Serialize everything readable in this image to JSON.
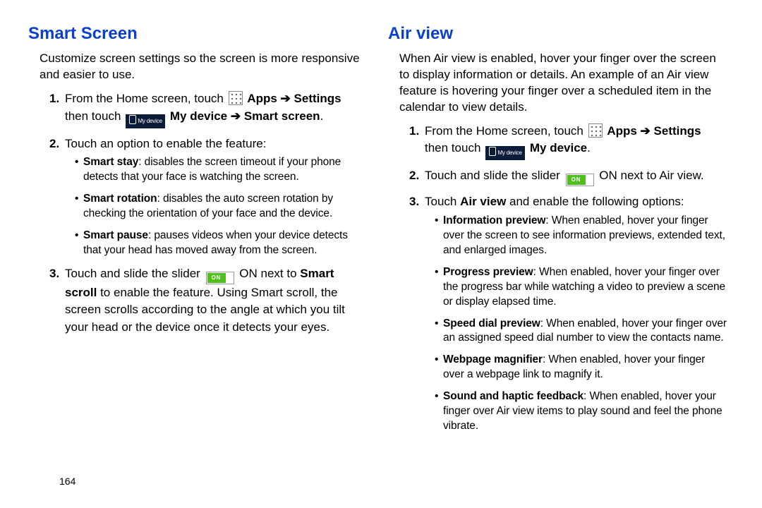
{
  "page_number": "164",
  "arrow": " ➔ ",
  "left": {
    "heading": "Smart Screen",
    "intro": "Customize screen settings so the screen is more responsive and easier to use.",
    "step1_a": "From the Home screen, touch ",
    "step1_apps": "Apps",
    "step1_settings": "Settings",
    "step1_b": "then touch ",
    "step1_mydevice": "My device",
    "step1_smartscreen": "Smart screen",
    "step2": "Touch an option to enable the feature:",
    "opt1_b": "Smart stay",
    "opt1_t": ": disables the screen timeout if your phone detects that your face is watching the screen.",
    "opt2_b": "Smart rotation",
    "opt2_t": ": disables the auto screen rotation by checking the orientation of your face and the device.",
    "opt3_b": "Smart pause",
    "opt3_t": ": pauses videos when your device detects that your head has moved away from the screen.",
    "step3_a": "Touch and slide the slider ",
    "step3_on": " ON next to ",
    "step3_smart": "Smart scroll",
    "step3_rest": " to enable the feature. Using Smart scroll, the screen scrolls according to the angle at which you tilt your head or the device once it detects your eyes.",
    "mydevice_icon_label": "My device",
    "slider_label": "ON"
  },
  "right": {
    "heading": "Air view",
    "intro": "When Air view is enabled, hover your finger over the screen to display information or details. An example of an Air view feature is hovering your finger over a scheduled item in the calendar to view details.",
    "step1_a": "From the Home screen, touch ",
    "step1_apps": "Apps",
    "step1_settings": "Settings",
    "step1_b": "then touch ",
    "step1_mydevice": "My device",
    "step2_a": "Touch and slide the slider ",
    "step2_b": " ON next to Air view.",
    "step3_a": "Touch ",
    "step3_airview": "Air view",
    "step3_b": " and enable the following options:",
    "opt1_b": "Information preview",
    "opt1_t": ": When enabled, hover your finger over the screen to see information previews, extended text, and enlarged images.",
    "opt2_b": "Progress preview",
    "opt2_t": ": When enabled, hover your finger over the progress bar while watching a video to preview a scene or display elapsed time.",
    "opt3_b": "Speed dial preview",
    "opt3_t": ": When enabled, hover your finger over an assigned speed dial number to view the contacts name.",
    "opt4_b": "Webpage magnifier",
    "opt4_t": ": When enabled, hover your finger over a webpage link to magnify it.",
    "opt5_b": "Sound and haptic feedback",
    "opt5_t": ": When enabled, hover your finger over Air view items to play sound and feel the phone vibrate.",
    "mydevice_icon_label": "My device",
    "slider_label": "ON"
  }
}
